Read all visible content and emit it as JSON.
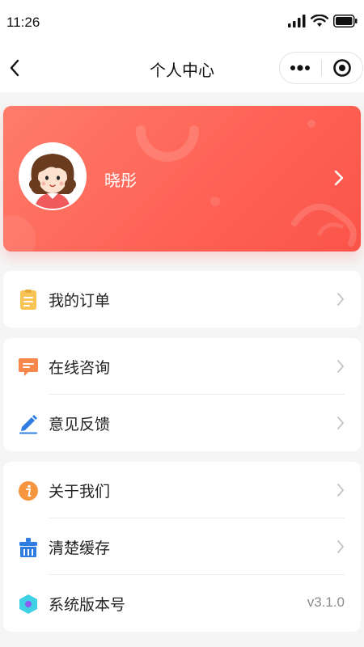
{
  "status_bar": {
    "time": "11:26"
  },
  "nav": {
    "title": "个人中心"
  },
  "profile": {
    "name": "晓彤"
  },
  "groups": [
    {
      "items": [
        {
          "label": "我的订单",
          "icon": "order-icon",
          "color": "#f8c455"
        }
      ]
    },
    {
      "items": [
        {
          "label": "在线咨询",
          "icon": "chat-icon",
          "color": "#f7874a"
        },
        {
          "label": "意见反馈",
          "icon": "feedback-icon",
          "color": "#2f7de1"
        }
      ]
    },
    {
      "items": [
        {
          "label": "关于我们",
          "icon": "info-icon",
          "color": "#f7963f"
        },
        {
          "label": "清楚缓存",
          "icon": "clear-cache-icon",
          "color": "#2f7de1"
        },
        {
          "label": "系统版本号",
          "icon": "version-icon",
          "color": "#3fd0e4",
          "value": "v3.1.0"
        }
      ]
    }
  ],
  "colors": {
    "card_gradient_start": "#ff7c6a",
    "card_gradient_end": "#fb5449",
    "background": "#f5f5f5"
  }
}
